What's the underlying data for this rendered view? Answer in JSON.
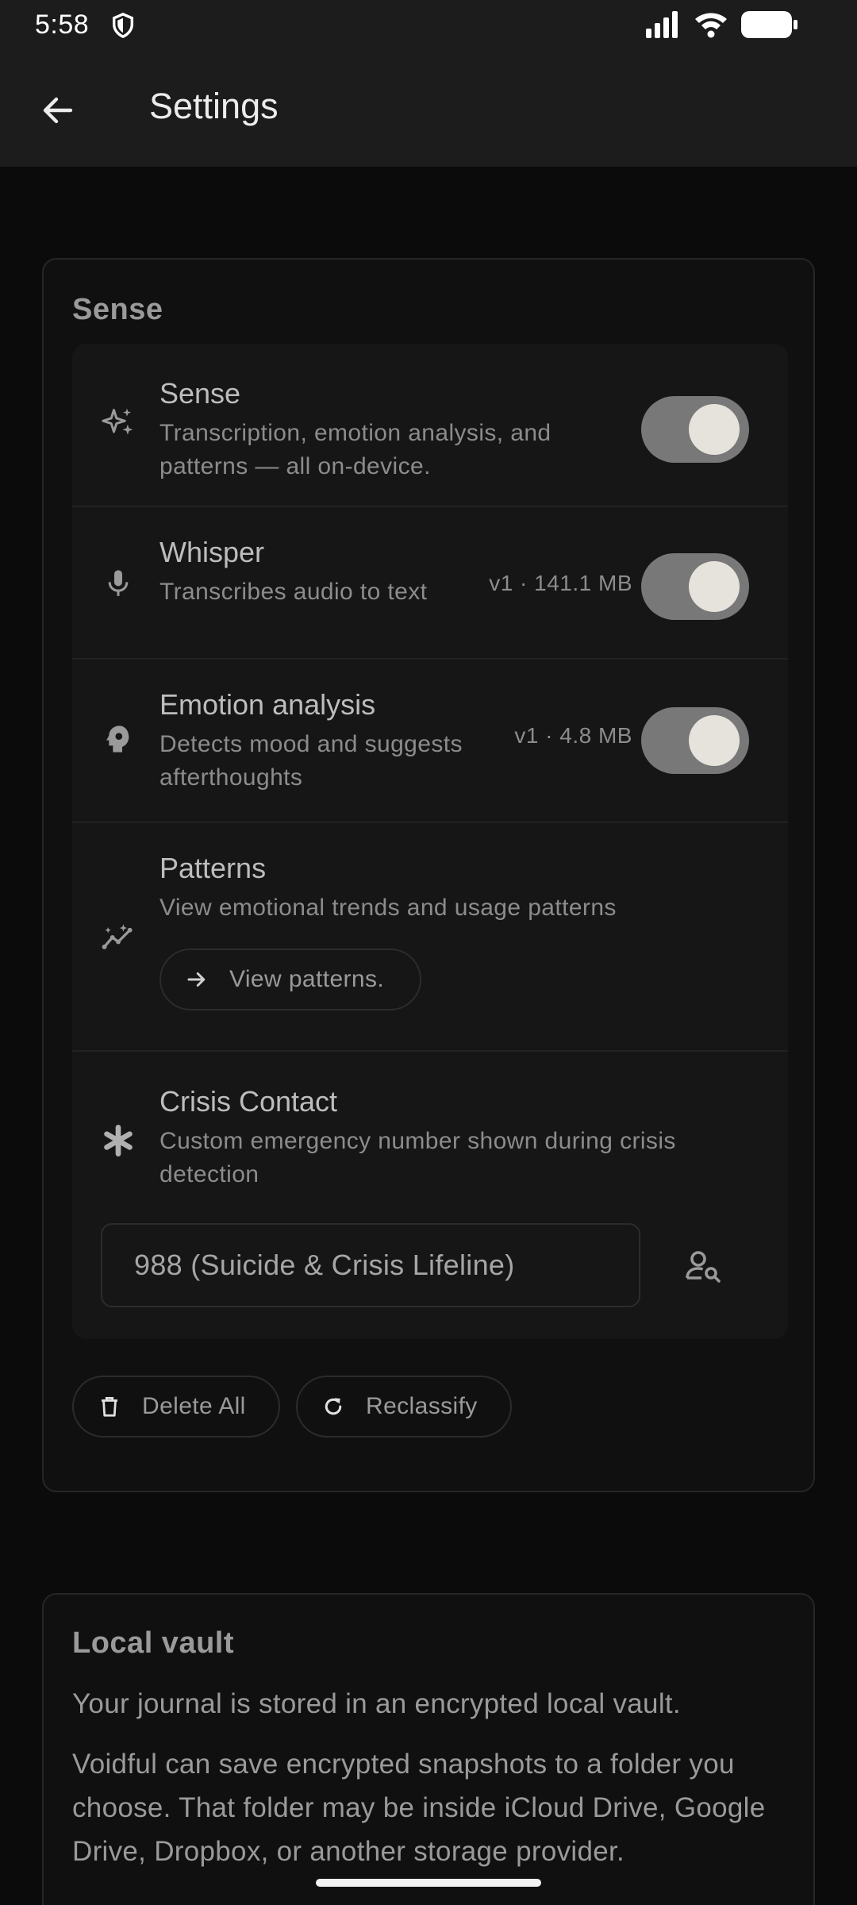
{
  "status_bar": {
    "time": "5:58",
    "icons": [
      "shield-icon",
      "signal-icon",
      "wifi-icon",
      "battery-icon"
    ]
  },
  "app_bar": {
    "title": "Settings",
    "back_icon": "arrow-back-icon"
  },
  "sense_section": {
    "title": "Sense",
    "rows": [
      {
        "icon": "sparkles-icon",
        "title": "Sense",
        "description": "Transcription, emotion analysis, and patterns — all on-device.",
        "toggle_on": true
      },
      {
        "icon": "microphone-icon",
        "title": "Whisper",
        "description": "Transcribes audio to text",
        "size": "v1 · 141.1 MB",
        "toggle_on": true
      },
      {
        "icon": "psychology-icon",
        "title": "Emotion analysis",
        "description": "Detects mood and suggests afterthoughts",
        "size": "v1 · 4.8 MB",
        "toggle_on": true
      },
      {
        "icon": "insights-icon",
        "title": "Patterns",
        "description": "View emotional trends and usage patterns",
        "button_label": "View patterns."
      },
      {
        "icon": "asterisk-icon",
        "title": "Crisis Contact",
        "description": "Custom emergency number shown during crisis detection",
        "field_value": "988 (Suicide & Crisis Lifeline)"
      }
    ],
    "actions": {
      "delete_all": "Delete All",
      "reclassify": "Reclassify"
    }
  },
  "vault_section": {
    "title": "Local vault",
    "line1": "Your journal is stored in an encrypted local vault.",
    "line2": "Voidful can save encrypted snapshots to a folder you choose. That folder may be inside iCloud Drive, Google Drive, Dropbox, or another storage provider."
  },
  "colors": {
    "background": "#0b0b0b",
    "app_bar": "#1c1c1c",
    "card": "#101010",
    "panel": "#161616",
    "toggle_track": "#787878",
    "toggle_knob": "#e6e2dc"
  }
}
